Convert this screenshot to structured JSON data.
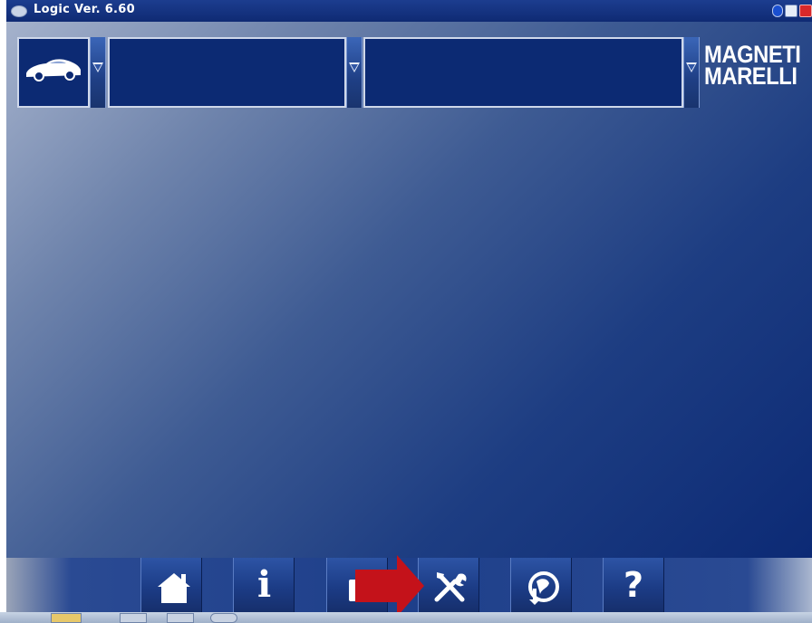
{
  "window": {
    "title": "Logic Ver. 6.60"
  },
  "titlebar_icons": [
    "app-logo-icon",
    "bluetooth-icon",
    "minimize-icon",
    "close-icon"
  ],
  "selectors": {
    "vehicle_icon": "car-icon",
    "field1_value": "",
    "field2_value": ""
  },
  "brand": {
    "line1": "MAGNETI",
    "line2": "MARELLI"
  },
  "toolbar": {
    "buttons": [
      {
        "name": "home",
        "icon": "home-icon"
      },
      {
        "name": "info",
        "icon": "info-icon",
        "glyph": "i"
      },
      {
        "name": "folder",
        "icon": "folder-icon"
      },
      {
        "name": "tools",
        "icon": "tools-icon"
      },
      {
        "name": "update",
        "icon": "globe-update-icon"
      },
      {
        "name": "help",
        "icon": "help-icon",
        "glyph": "?"
      }
    ]
  },
  "annotation": {
    "icon": "red-arrow-icon",
    "color": "#c4121a"
  },
  "colors": {
    "panel_blue": "#0c2a73",
    "accent_blue": "#1e3f8a",
    "close_red": "#d8282a"
  }
}
